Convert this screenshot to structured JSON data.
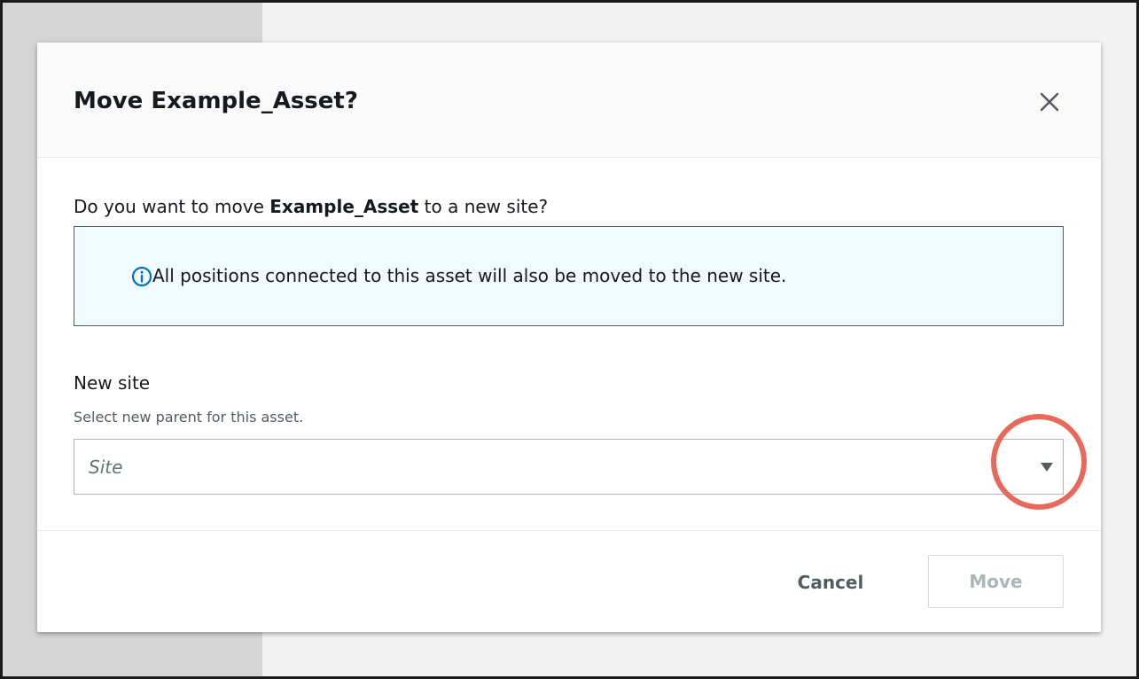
{
  "modal": {
    "title": "Move Example_Asset?",
    "prompt_prefix": "Do you want to move ",
    "prompt_asset": "Example_Asset",
    "prompt_suffix": " to a new site?",
    "alert_text": "All positions connected to this asset will also be moved to the new site.",
    "field": {
      "label": "New site",
      "description": "Select new parent for this asset.",
      "placeholder": "Site"
    },
    "buttons": {
      "cancel": "Cancel",
      "move": "Move"
    }
  },
  "icons": {
    "close": "close-icon",
    "info": "info-icon",
    "caret": "caret-down-icon"
  },
  "colors": {
    "alert_border": "#0073bb",
    "alert_background": "#f1faff",
    "highlight_ring": "#e8685a",
    "disabled_text": "#aab7b8"
  }
}
